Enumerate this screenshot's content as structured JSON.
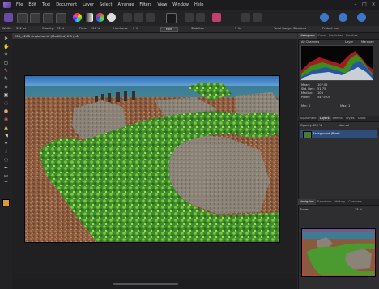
{
  "menu": [
    "File",
    "Edit",
    "Text",
    "Document",
    "Layer",
    "Select",
    "Arrange",
    "Filters",
    "View",
    "Window",
    "Help"
  ],
  "context": {
    "width_label": "Width:",
    "width_value": "392 px",
    "opacity_label": "Opacity:",
    "opacity_value": "73 %",
    "flow_label": "Flow:",
    "flow_value": "100 %",
    "hardness_label": "Hardness:",
    "hardness_value": "0 %",
    "more": "More",
    "stabiliser": "Stabiliser",
    "tonal_range_label": "Tonal Range:",
    "tonal_range_value": "Shadows",
    "protect_hue": "Protect hue",
    "strength_value": "5 %"
  },
  "document": {
    "tab_title": "IMG_4208 single lux.tif (Modified) 2.5 (16)"
  },
  "histogram_panel": {
    "tabs": [
      "Histogram",
      "Color",
      "Swatches",
      "Brushes"
    ],
    "channel": "All Channels",
    "layer_option": "Layer",
    "marquee_option": "Marquee",
    "stats": [
      {
        "label": "Mean:",
        "value": "107.02"
      },
      {
        "label": "Std. Dev.:",
        "value": "51.75"
      },
      {
        "label": "Median:",
        "value": "106"
      },
      {
        "label": "Pixels:",
        "value": "5471904"
      }
    ],
    "min_label": "Min:",
    "min_value": "0",
    "max_label": "Max:",
    "max_value": "1"
  },
  "layers_panel": {
    "tabs": [
      "Adjustment",
      "Layers",
      "Effects",
      "Styles",
      "Stock"
    ],
    "opacity_label": "Opacity:",
    "opacity_value": "100 %",
    "blend": "Normal",
    "layer_name": "Background (Pixel)"
  },
  "navigator_panel": {
    "tabs": [
      "Navigator",
      "Transform",
      "History",
      "Channels"
    ],
    "zoom_label": "Zoom:",
    "zoom_value": "75 %"
  }
}
